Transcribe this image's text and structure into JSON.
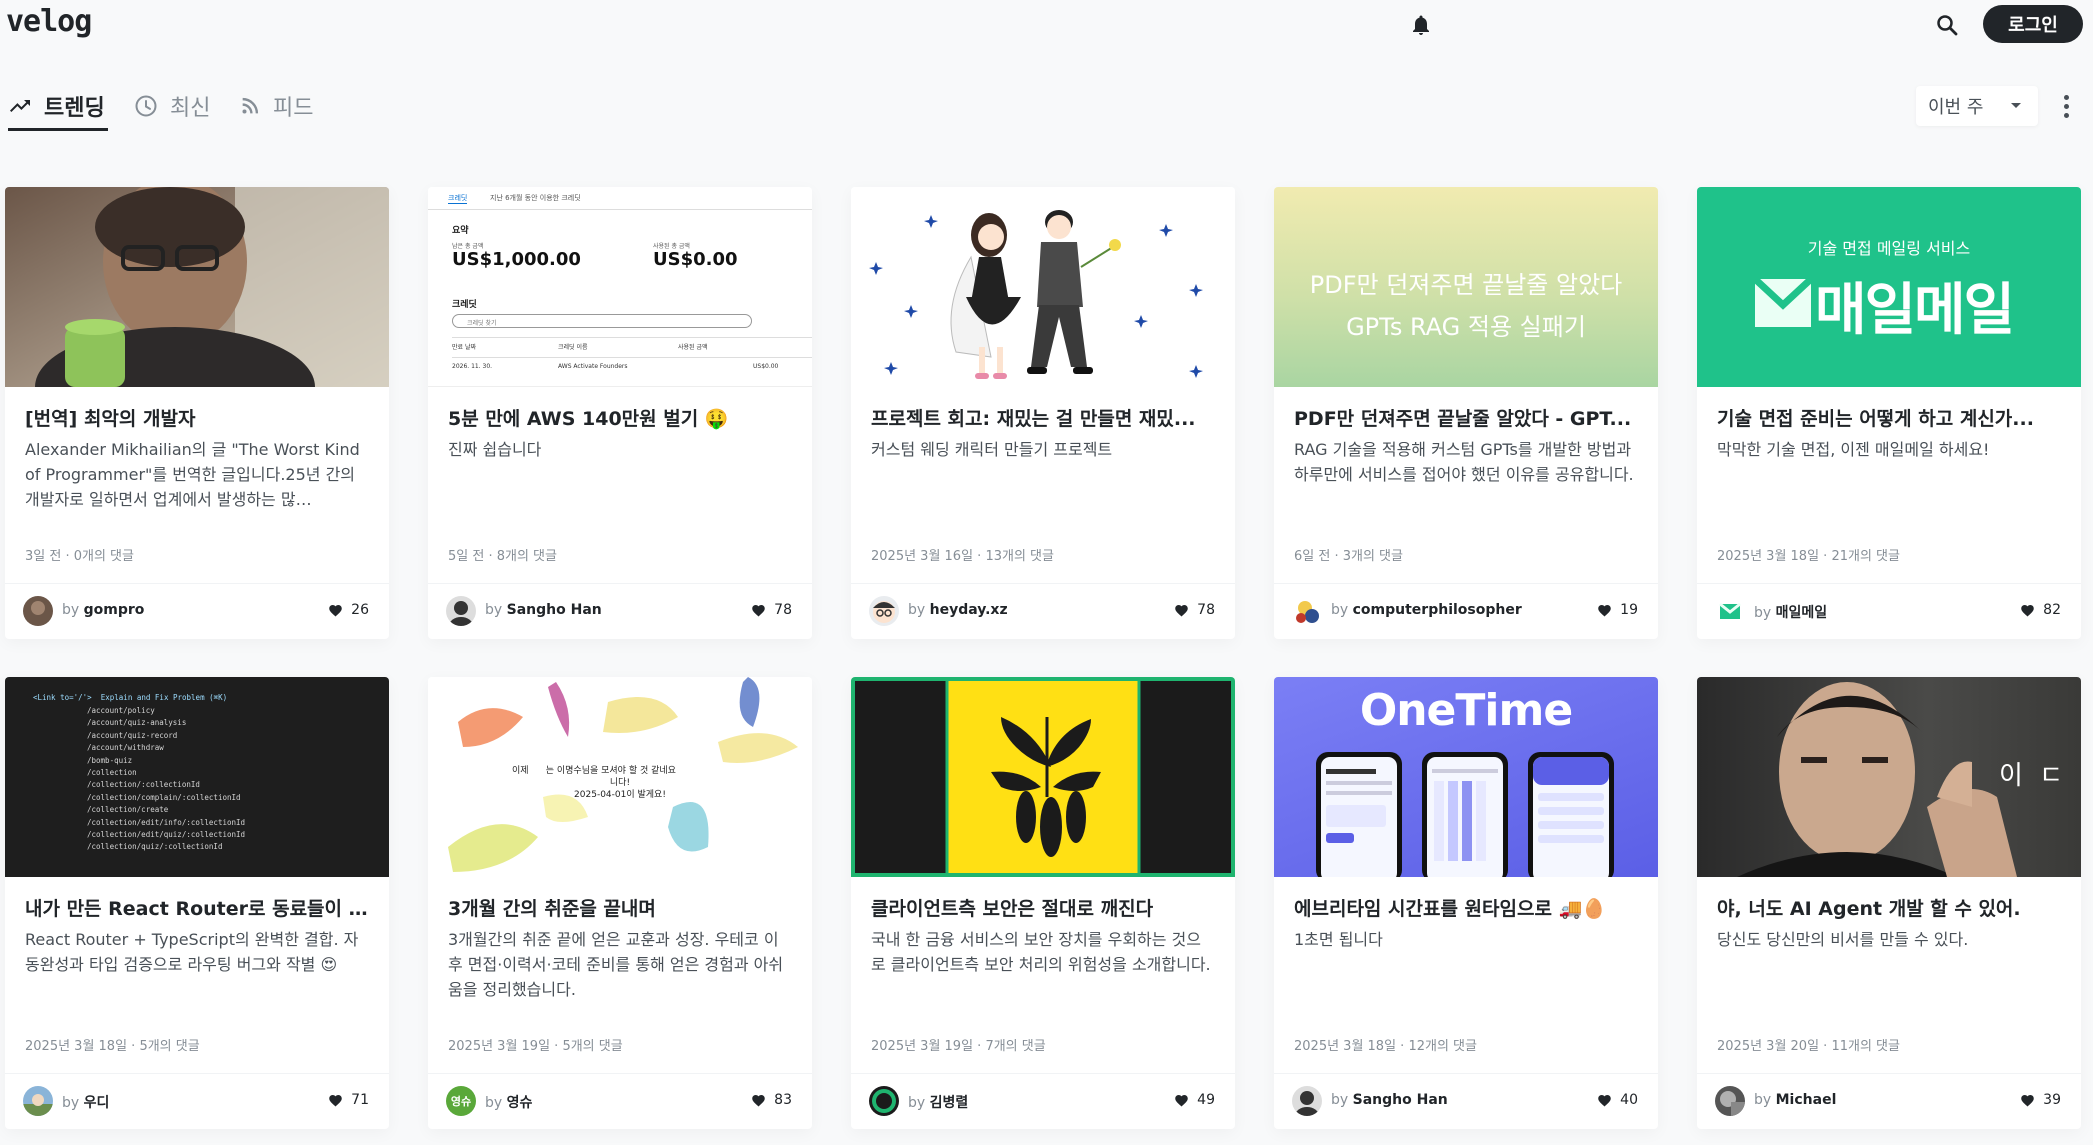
{
  "header": {
    "logo": "velog",
    "login_label": "로그인"
  },
  "tabs": [
    {
      "label": "트렌딩",
      "icon": "trending-icon"
    },
    {
      "label": "최신",
      "icon": "clock-icon"
    },
    {
      "label": "피드",
      "icon": "rss-icon"
    }
  ],
  "period": {
    "selected": "이번 주"
  },
  "colors": {
    "accent": "#212529",
    "background": "#f8f9fa",
    "muted": "#868e96"
  },
  "cards": [
    {
      "title": "[번역] 최악의 개발자",
      "desc": "Alexander Mikhailian의 글 \"The Worst Kind of Programmer\"를 번역한 글입니다.25년 간의 개발자로 일하면서 업계에서 발생하는 많…",
      "meta": "3일 전 · 0개의 댓글",
      "by": "by",
      "author": "gompro",
      "likes": "26"
    },
    {
      "title": "5분 만에 AWS 140만원 벌기 🤑",
      "desc": "진짜 쉽습니다",
      "meta": "5일 전 · 8개의 댓글",
      "by": "by",
      "author": "Sangho Han",
      "likes": "78"
    },
    {
      "title": "프로젝트 회고: 재밌는 걸 만들면 재밌...",
      "desc": "커스텀 웨딩 캐릭터 만들기 프로젝트",
      "meta": "2025년 3월 16일 · 13개의 댓글",
      "by": "by",
      "author": "heyday.xz",
      "likes": "78"
    },
    {
      "title": "PDF만 던져주면 끝날줄 알았다 - GPT...",
      "desc": "RAG 기술을 적용해 커스텀 GPTs를 개발한 방법과 하루만에 서비스를 접어야 했던 이유를 공유합니다.",
      "meta": "6일 전 · 3개의 댓글",
      "by": "by",
      "author": "computerphilosopher",
      "likes": "19"
    },
    {
      "title": "기술 면접 준비는 어떻게 하고 계신가...",
      "desc": "막막한 기술 면접, 이젠 매일메일 하세요!",
      "meta": "2025년 3월 18일 · 21개의 댓글",
      "by": "by",
      "author": "매일메일",
      "likes": "82"
    },
    {
      "title": "내가 만든 React Router로 동료들이 ...",
      "desc": "React Router + TypeScript의 완벽한 결합. 자동완성과 타입 검증으로 라우팅 버그와 작별 😍",
      "meta": "2025년 3월 18일 · 5개의 댓글",
      "by": "by",
      "author": "우디",
      "likes": "71"
    },
    {
      "title": "3개월 간의 취준을 끝내며",
      "desc": "3개월간의 취준 끝에 얻은 교훈과 성장. 우테코 이후 면접·이력서·코테 준비를 통해 얻은 경험과 아쉬움을 정리했습니다.",
      "meta": "2025년 3월 19일 · 5개의 댓글",
      "by": "by",
      "author": "영슈",
      "likes": "83"
    },
    {
      "title": "클라이언트측 보안은 절대로 깨진다",
      "desc": "국내 한 금융 서비스의 보안 장치를 우회하는 것으로 클라이언트측 보안 처리의 위험성을 소개합니다.",
      "meta": "2025년 3월 19일 · 7개의 댓글",
      "by": "by",
      "author": "김병렬",
      "likes": "49"
    },
    {
      "title": "에브리타임 시간표를 원타임으로 🚚🥚",
      "desc": "1초면 됩니다",
      "meta": "2025년 3월 18일 · 12개의 댓글",
      "by": "by",
      "author": "Sangho Han",
      "likes": "40"
    },
    {
      "title": "야, 너도 AI Agent 개발 할 수 있어.",
      "desc": "당신도 당신만의 비서를 만들 수 있다.",
      "meta": "2025년 3월 20일 · 11개의 댓글",
      "by": "by",
      "author": "Michael",
      "likes": "39"
    }
  ],
  "thumbs": {
    "aws": {
      "tab1": "크레딧",
      "tab2": "지난 6개월 동안 이용한 크레딧",
      "summary": "요약",
      "label_a": "남은 총 금액",
      "value_a": "US$1,000.00",
      "label_b": "사용된 총 금액",
      "value_b": "US$0.00",
      "credit": "크레딧",
      "search": "크레딧 찾기",
      "col1": "만료 날짜",
      "col2": "크레딧 이름",
      "col3": "사용된 금액",
      "row_date": "2026. 11. 30.",
      "row_name": "AWS Activate Founders",
      "row_amount": "US$0.00"
    },
    "pdf": {
      "line1": "PDF만 던져주면 끝날줄 알았다",
      "line2": "GPTs RAG 적용 실패기"
    },
    "maeil": {
      "sub": "기술 면접 메일링 서비스",
      "brand": "매일메일"
    },
    "code": {
      "lines": [
        "<Link to='/'>  Explain and Fix Problem (⌘K)",
        "/account/policy",
        "/account/quiz-analysis",
        "/account/quiz-record",
        "/account/withdraw",
        "/bomb-quiz",
        "/collection",
        "/collection/:collectionId",
        "/collection/complain/:collectionId",
        "/collection/create",
        "/collection/edit/info/:collectionId",
        "/collection/edit/quiz/:collectionId",
        "/collection/quiz/:collectionId"
      ]
    },
    "paint": {
      "line1": "이제      는 이명수님을 모셔야 할 것 같네요",
      "line2": "니다!",
      "line3": "2025-04-01이 발게요!"
    },
    "onetime": {
      "brand": "OneTime"
    },
    "video": {
      "text": "이 ㄷ"
    }
  }
}
